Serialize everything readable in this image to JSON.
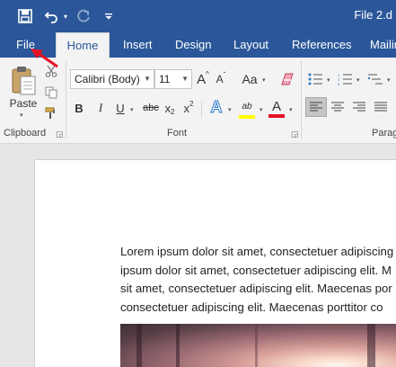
{
  "window": {
    "doc_title": "File 2.d"
  },
  "quick_access": {
    "save_icon": "save-icon",
    "undo_icon": "undo-icon",
    "redo_icon": "redo-icon",
    "customize_icon": "customize-qat-icon"
  },
  "tabs": [
    {
      "label": "File"
    },
    {
      "label": "Home"
    },
    {
      "label": "Insert"
    },
    {
      "label": "Design"
    },
    {
      "label": "Layout"
    },
    {
      "label": "References"
    },
    {
      "label": "Mailin"
    }
  ],
  "ribbon": {
    "clipboard": {
      "paste_label": "Paste",
      "group_label": "Clipboard"
    },
    "font": {
      "font_name": "Calibri (Body)",
      "font_size": "11",
      "grow_label": "A",
      "shrink_label": "A",
      "case_label": "Aa",
      "bold_label": "B",
      "italic_label": "I",
      "underline_label": "U",
      "strike_label": "abc",
      "subscript_label": "x",
      "subscript_sub": "2",
      "superscript_label": "x",
      "superscript_sup": "2",
      "effects_label": "A",
      "highlight_label": "ab",
      "font_color_label": "A",
      "group_label": "Font"
    },
    "paragraph": {
      "group_label": "Parag"
    }
  },
  "document": {
    "lines": [
      "Lorem ipsum dolor sit amet, consectetuer adipiscing",
      "ipsum dolor sit amet, consectetuer adipiscing elit. M",
      "sit amet, consectetuer adipiscing elit. Maecenas por",
      "consectetuer adipiscing elit. Maecenas porttitor co"
    ]
  },
  "colors": {
    "accent": "#2b579a",
    "highlight": "#ffff00",
    "font_color": "#e81123",
    "annotation": "#e81123"
  }
}
